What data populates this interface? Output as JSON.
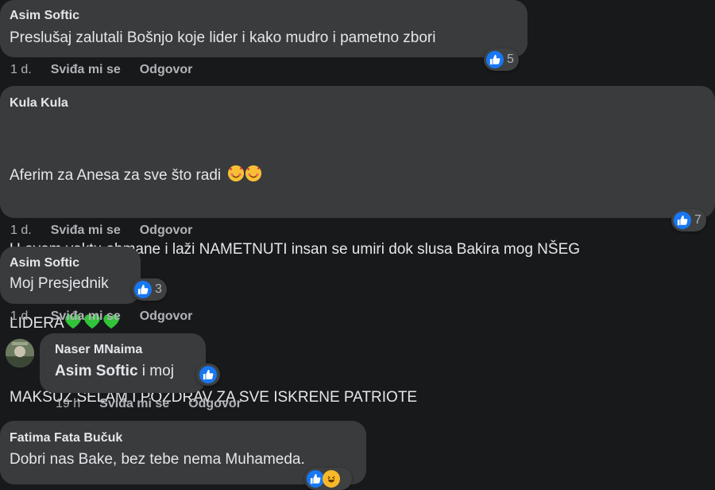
{
  "comments": [
    {
      "author": "Asim Softic",
      "text": "Preslušaj zalutali Bošnjo koje lider i kako mudro i pametno zbori",
      "time": "1 d.",
      "like_label": "Sviđa mi se",
      "reply_label": "Odgovor",
      "reaction_count": "5",
      "reaction_icons": [
        "like-icon"
      ]
    },
    {
      "author": "Kula Kula",
      "lines": [
        "Aferim za Anesa za sve što radi",
        "U ovom vaktu obmane i laži NAMETNUTI insan se umiri dok slusa Bakira mog NŠEG",
        "LIDERA",
        "MAKSUZ SELAM I POZDRAV ZA SVE ISKRENE PATRIOTE"
      ],
      "emoji_line1": [
        "smiling-face-with-hearts-icon",
        "smiling-face-with-hearts-icon"
      ],
      "emoji_line3": [
        "green-heart-icon",
        "green-heart-icon",
        "green-heart-icon"
      ],
      "time": "1 d.",
      "like_label": "Sviđa mi se",
      "reply_label": "Odgovor",
      "reaction_count": "7",
      "reaction_icons": [
        "like-icon"
      ]
    },
    {
      "author": "Asim Softic",
      "text": "Moj Presjednik",
      "time": "1 d.",
      "like_label": "Sviđa mi se",
      "reply_label": "Odgovor",
      "reaction_count": "3",
      "reaction_icons": [
        "like-icon"
      ]
    },
    {
      "author": "Naser MNaima",
      "mention": "Asim Softic",
      "text": " i moj",
      "time": "19 h",
      "like_label": "Sviđa mi se",
      "reply_label": "Odgovor",
      "reaction_icons": [
        "like-icon"
      ]
    },
    {
      "author": "Fatima Fata Bučuk",
      "text": "Dobri nas Bake, bez tebe nema Muhameda.",
      "reaction_icons": [
        "like-icon",
        "haha-icon"
      ]
    }
  ],
  "colors": {
    "background": "#18191a",
    "bubble": "#3a3b3c",
    "text": "#e4e6eb",
    "meta": "#b0b3b8",
    "like_blue": "#1877f2",
    "green_heart": "#31c43a"
  }
}
